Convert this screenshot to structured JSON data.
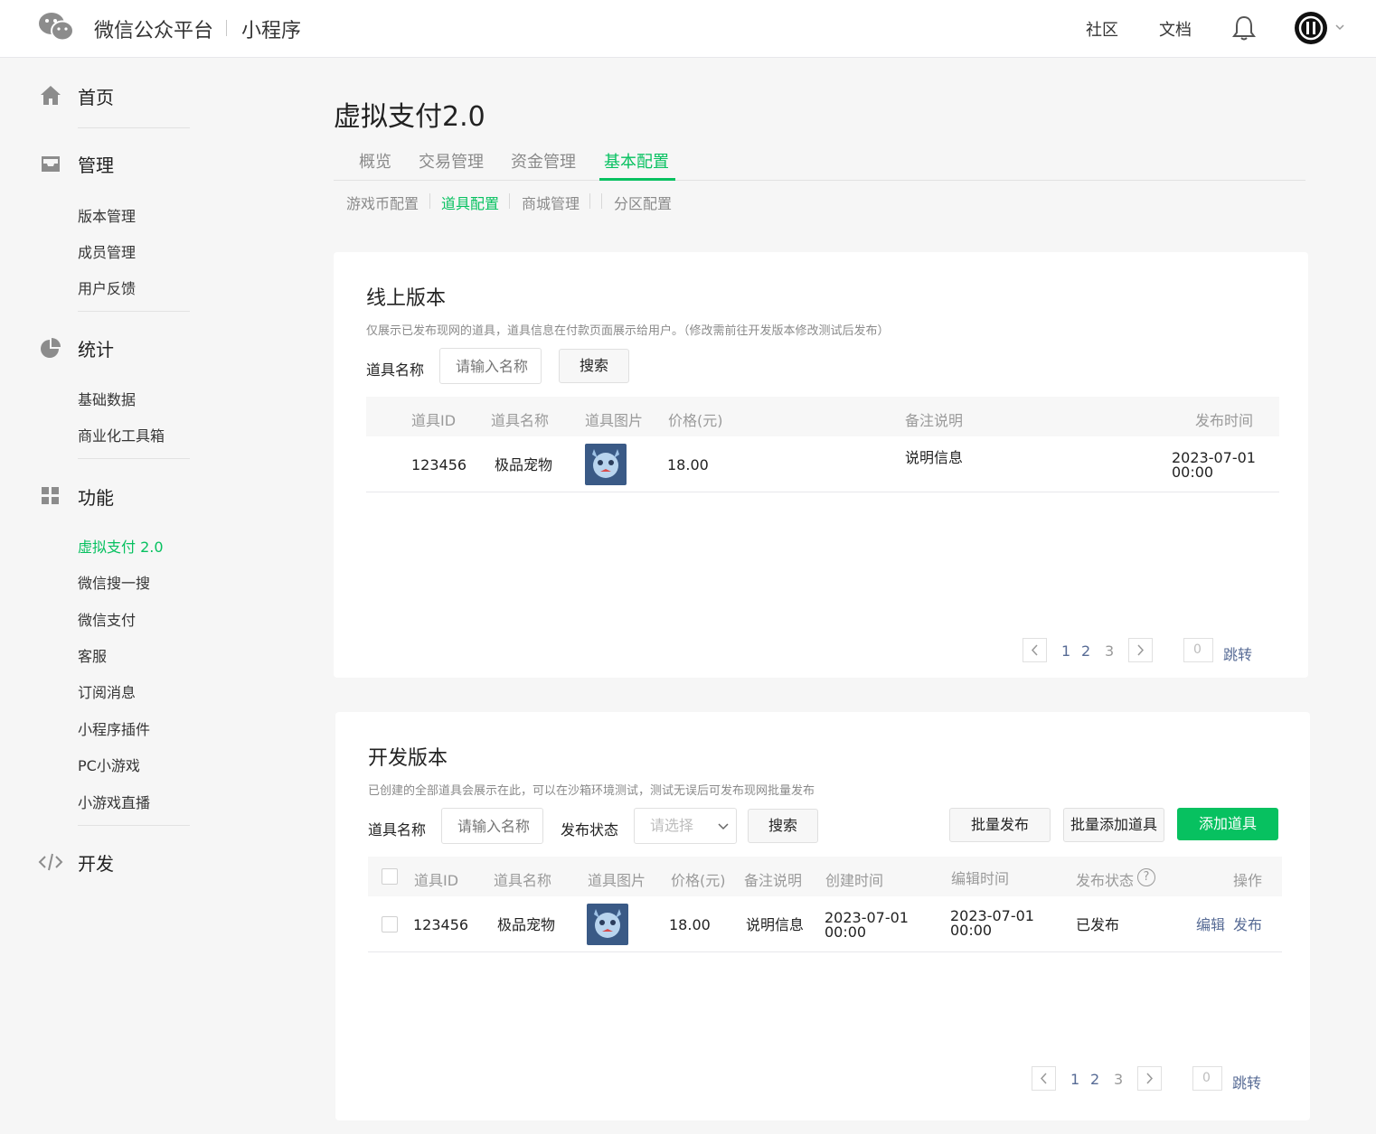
{
  "header": {
    "brand": "微信公众平台",
    "product": "小程序",
    "links": [
      "社区",
      "文档"
    ],
    "icons": [
      "wechat-logo-icon",
      "bell-icon",
      "chevron-down-icon"
    ]
  },
  "sidebar": {
    "home": "首页",
    "manage": {
      "label": "管理",
      "items": [
        "版本管理",
        "成员管理",
        "用户反馈"
      ]
    },
    "stats": {
      "label": "统计",
      "items": [
        "基础数据",
        "商业化工具箱"
      ]
    },
    "features": {
      "label": "功能",
      "items": [
        "虚拟支付 2.0",
        "微信搜一搜",
        "微信支付",
        "客服",
        "订阅消息",
        "小程序插件",
        "PC小游戏",
        "小游戏直播"
      ],
      "active_index": 0
    },
    "dev": "开发"
  },
  "page": {
    "title": "虚拟支付2.0",
    "tabs": [
      "概览",
      "交易管理",
      "资金管理",
      "基本配置"
    ],
    "active_tab": 3,
    "subtabs": [
      "游戏币配置",
      "道具配置",
      "商城管理",
      "分区配置"
    ],
    "active_subtab": 1
  },
  "online": {
    "title": "线上版本",
    "desc": "仅展示已发布现网的道具，道具信息在付款页面展示给用户。（修改需前往开发版本修改测试后发布）",
    "name_label": "道具名称",
    "name_placeholder": "请输入名称",
    "search": "搜索",
    "columns": [
      "道具ID",
      "道具名称",
      "道具图片",
      "价格(元)",
      "备注说明",
      "发布时间"
    ],
    "row": {
      "id": "123456",
      "name": "极品宠物",
      "price": "18.00",
      "note": "说明信息",
      "time_date": "2023-07-01",
      "time_clock": "00:00"
    },
    "pagination": {
      "pages": [
        "1",
        "2",
        "3"
      ],
      "jump_value": "0",
      "jump": "跳转"
    }
  },
  "dev": {
    "title": "开发版本",
    "desc": "已创建的全部道具会展示在此，可以在沙箱环境测试，测试无误后可发布现网批量发布",
    "name_label": "道具名称",
    "name_placeholder": "请输入名称",
    "status_label": "发布状态",
    "status_placeholder": "请选择",
    "search": "搜索",
    "batch_publish": "批量发布",
    "batch_add": "批量添加道具",
    "add": "添加道具",
    "columns": [
      "道具ID",
      "道具名称",
      "道具图片",
      "价格(元)",
      "备注说明",
      "创建时间",
      "编辑时间",
      "发布状态",
      "操作"
    ],
    "help_glyph": "?",
    "row": {
      "id": "123456",
      "name": "极品宠物",
      "price": "18.00",
      "note": "说明信息",
      "created_date": "2023-07-01",
      "created_clock": "00:00",
      "edited_date": "2023-07-01",
      "edited_clock": "00:00",
      "status": "已发布",
      "edit": "编辑",
      "publish": "发布"
    },
    "pagination": {
      "pages": [
        "1",
        "2",
        "3"
      ],
      "jump_value": "0",
      "jump": "跳转"
    }
  },
  "colors": {
    "accent": "#07c160",
    "link": "#576b95",
    "text": "#353535",
    "muted": "#8a8a8a"
  }
}
